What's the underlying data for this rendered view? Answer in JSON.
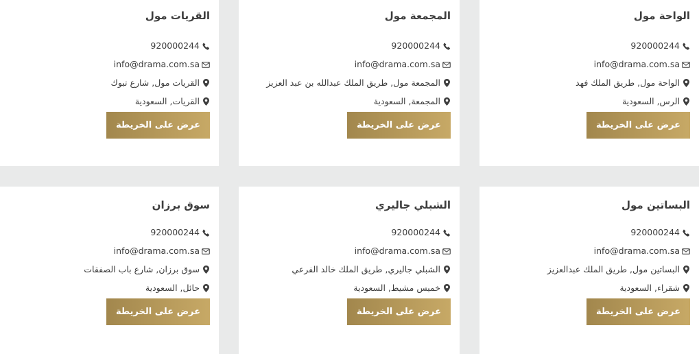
{
  "stores": [
    {
      "name": "الواحة مول",
      "phone": "920000244",
      "email": "info@drama.com.sa",
      "address": "الواحة مول, طريق الملك فهد",
      "city": "الرس, السعودية",
      "button": "عرض على الخريطة"
    },
    {
      "name": "المجمعة مول",
      "phone": "920000244",
      "email": "info@drama.com.sa",
      "address": "المجمعة مول, طريق الملك عبدالله بن عبد العزيز",
      "city": "المجمعة, السعودية",
      "button": "عرض على الخريطة"
    },
    {
      "name": "القريات مول",
      "phone": "920000244",
      "email": "info@drama.com.sa",
      "address": "القريات مول, شارع تبوك",
      "city": "القريات, السعودية",
      "button": "عرض على الخريطة"
    },
    {
      "name": "البساتين مول",
      "phone": "920000244",
      "email": "info@drama.com.sa",
      "address": "البساتين مول, طريق الملك عبدالعزيز",
      "city": "شقراء, السعودية",
      "button": "عرض على الخريطة"
    },
    {
      "name": "الشبلي جاليري",
      "phone": "920000244",
      "email": "info@drama.com.sa",
      "address": "الشبلي جاليري, طريق الملك خالد الفرعي",
      "city": "خميس مشيط, السعودية",
      "button": "عرض على الخريطة"
    },
    {
      "name": "سوق برزان",
      "phone": "920000244",
      "email": "info@drama.com.sa",
      "address": "سوق برزان, شارع باب الصفقات",
      "city": "حائل, السعودية",
      "button": "عرض على الخريطة"
    }
  ],
  "icons": {
    "phone": "phone-icon",
    "email": "envelope-icon",
    "location": "map-marker-icon"
  },
  "colors": {
    "page_background": "#e9eaea",
    "card_background": "#ffffff",
    "text": "#3d3d3d",
    "button_gradient_start": "#a2874d",
    "button_gradient_end": "#c7a966",
    "button_text": "#ffffff"
  }
}
